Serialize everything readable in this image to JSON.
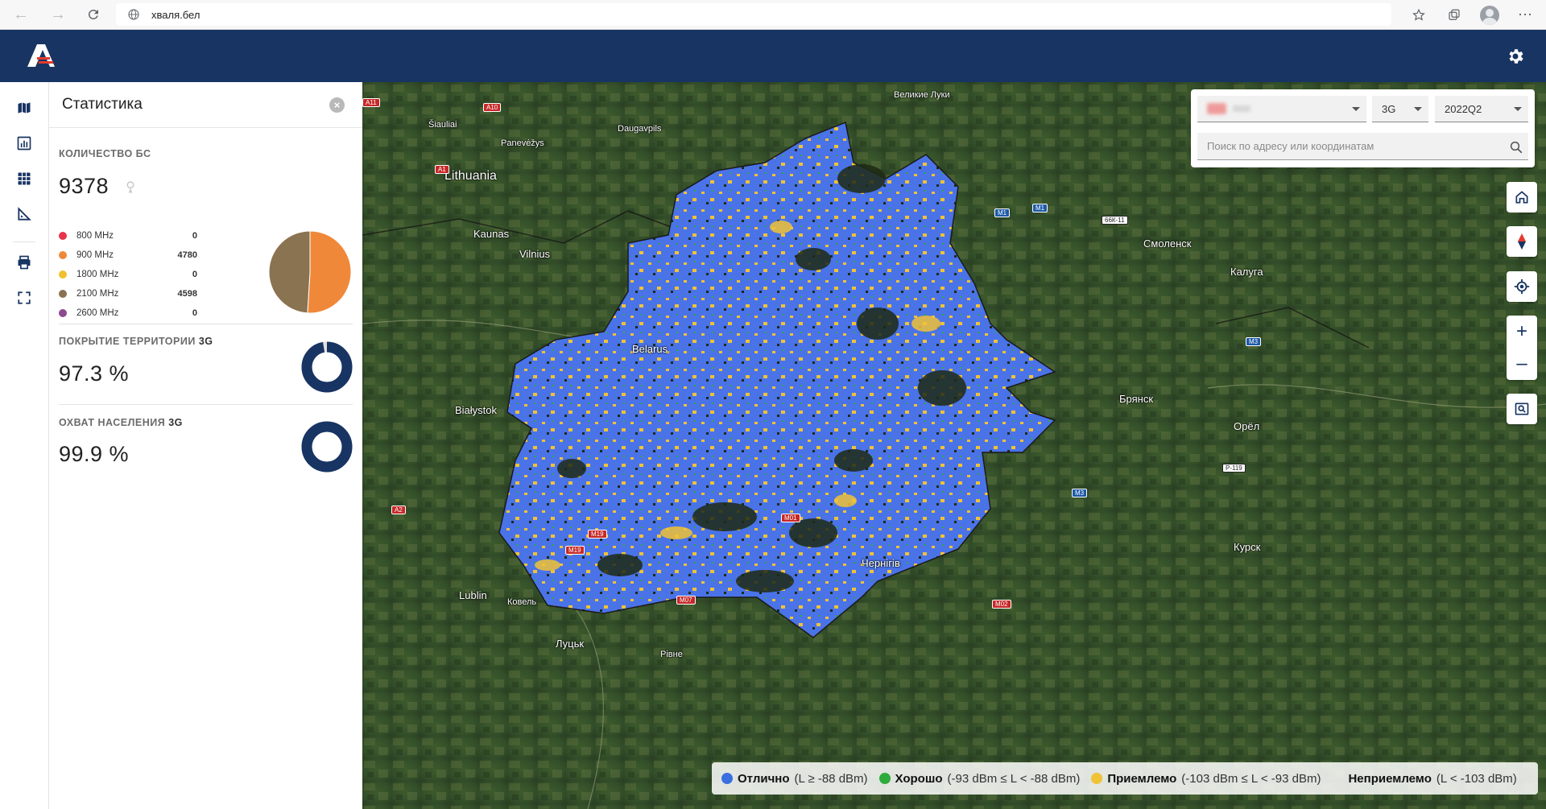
{
  "browser": {
    "url": "хваля.бел"
  },
  "panel": {
    "title": "Статистика",
    "bs_count": {
      "label": "КОЛИЧЕСТВО БС",
      "value": "9378",
      "bands": [
        {
          "label": "800 MHz",
          "count": "0",
          "color": "#e8334a"
        },
        {
          "label": "900 MHz",
          "count": "4780",
          "color": "#f0883a"
        },
        {
          "label": "1800 MHz",
          "count": "0",
          "color": "#f0c030"
        },
        {
          "label": "2100 MHz",
          "count": "4598",
          "color": "#8a7350"
        },
        {
          "label": "2600 MHz",
          "count": "0",
          "color": "#8e4a8e"
        }
      ]
    },
    "territory": {
      "label": "ПОКРЫТИЕ ТЕРРИТОРИИ",
      "tech": "3G",
      "value": "97.3 %",
      "fraction": 0.973
    },
    "population": {
      "label": "ОХВАТ НАСЕЛЕНИЯ",
      "tech": "3G",
      "value": "99.9 %",
      "fraction": 0.999
    }
  },
  "filters": {
    "technology": "3G",
    "period": "2022Q2",
    "search_placeholder": "Поиск по адресу или координатам"
  },
  "map": {
    "labels": {
      "lithuania": "Lithuania",
      "vilnius": "Vilnius",
      "kaunas": "Kaunas",
      "siauliai": "Šiauliai",
      "panevezys": "Panevėžys",
      "daugavpils": "Daugavpils",
      "smolensk": "Смоленск",
      "bryansk": "Брянск",
      "kaluga": "Калуга",
      "bialystok": "Białystok",
      "lublin": "Lublin",
      "chernihiv": "Чернігів",
      "orel": "Орёл",
      "kursk": "Курск",
      "velikie_luki": "Великие Луки",
      "belarus": "Belarus",
      "lutsk": "Луцьк",
      "rivne": "Рівне",
      "kovel": "Ковель"
    }
  },
  "legend": [
    {
      "name": "Отлично",
      "range": "(L ≥ -88 dBm)",
      "color": "#3b6fe0"
    },
    {
      "name": "Хорошо",
      "range": "(-93 dBm ≤ L < -88 dBm)",
      "color": "#2eab3c"
    },
    {
      "name": "Приемлемо",
      "range": "(-103 dBm ≤ L < -93 dBm)",
      "color": "#f0c236"
    },
    {
      "name": "Неприемлемо",
      "range": "(L < -103 dBm)",
      "color": ""
    }
  ]
}
